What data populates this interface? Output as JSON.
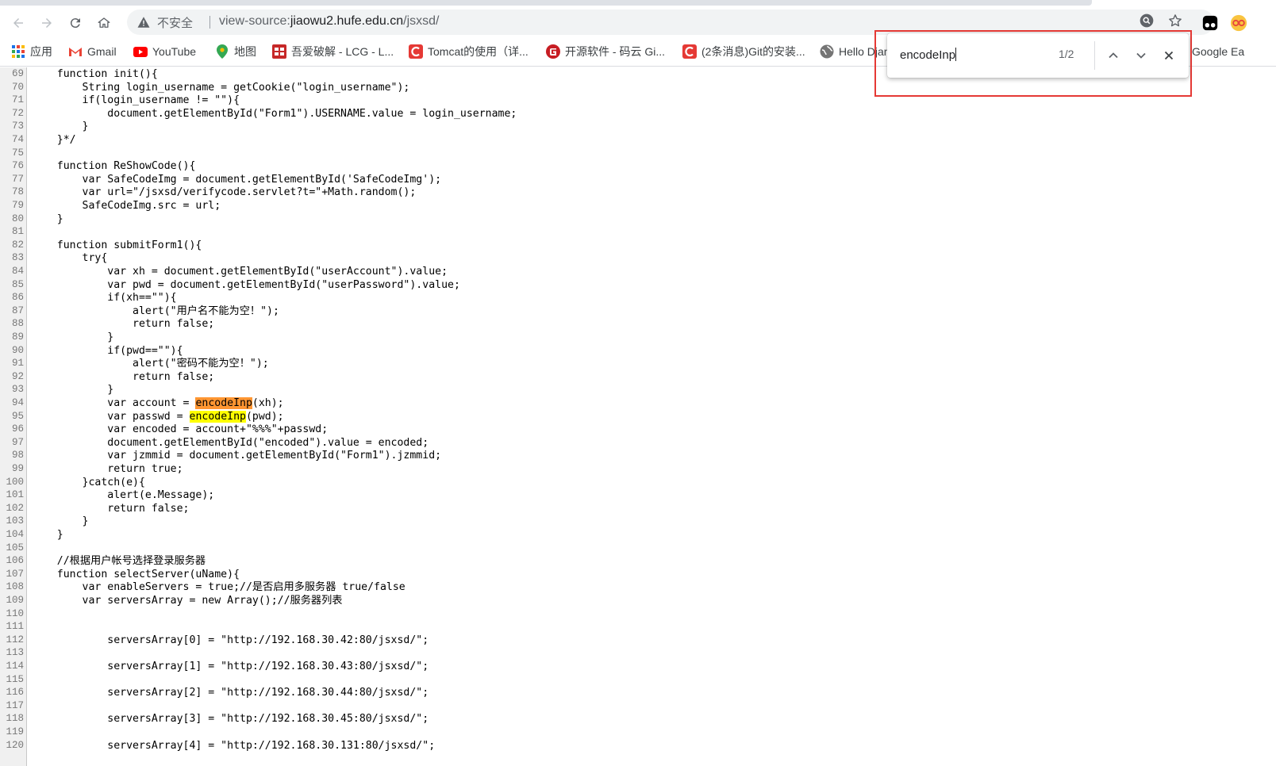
{
  "browser": {
    "insecure_label": "不安全",
    "url_prefix": "view-source:",
    "url_host": "jiaowu2.hufe.edu.cn",
    "url_path": "/jsxsd/"
  },
  "bookmarks": [
    {
      "label": "应用",
      "icon": "apps-grid-icon"
    },
    {
      "label": "Gmail",
      "icon": "gmail-icon"
    },
    {
      "label": "YouTube",
      "icon": "youtube-icon"
    },
    {
      "label": "地图",
      "icon": "maps-pin-icon"
    },
    {
      "label": "吾爱破解 - LCG - L...",
      "icon": "52pojie-icon"
    },
    {
      "label": "Tomcat的使用（详...",
      "icon": "csdn-icon"
    },
    {
      "label": "开源软件 - 码云 Gi...",
      "icon": "gitee-icon"
    },
    {
      "label": "(2条消息)Git的安装...",
      "icon": "csdn-icon"
    },
    {
      "label": "Hello Djan",
      "icon": "globe-icon"
    },
    {
      "label": "Google Ea",
      "icon": "google-earth-icon"
    }
  ],
  "find_bar": {
    "query": "encodeInp",
    "count": "1/2"
  },
  "source": {
    "lines": [
      {
        "n": "69",
        "text": "    function init(){"
      },
      {
        "n": "70",
        "text": "        String login_username = getCookie(\"login_username\");"
      },
      {
        "n": "71",
        "text": "        if(login_username != \"\"){"
      },
      {
        "n": "72",
        "text": "            document.getElementById(\"Form1\").USERNAME.value = login_username;"
      },
      {
        "n": "73",
        "text": "        }"
      },
      {
        "n": "74",
        "text": "    }*/"
      },
      {
        "n": "75",
        "text": ""
      },
      {
        "n": "76",
        "text": "    function ReShowCode(){"
      },
      {
        "n": "77",
        "text": "        var SafeCodeImg = document.getElementById('SafeCodeImg');"
      },
      {
        "n": "78",
        "text": "        var url=\"/jsxsd/verifycode.servlet?t=\"+Math.random();"
      },
      {
        "n": "79",
        "text": "        SafeCodeImg.src = url;"
      },
      {
        "n": "80",
        "text": "    }"
      },
      {
        "n": "81",
        "text": ""
      },
      {
        "n": "82",
        "text": "    function submitForm1(){"
      },
      {
        "n": "83",
        "text": "        try{"
      },
      {
        "n": "84",
        "text": "            var xh = document.getElementById(\"userAccount\").value;"
      },
      {
        "n": "85",
        "text": "            var pwd = document.getElementById(\"userPassword\").value;"
      },
      {
        "n": "86",
        "text": "            if(xh==\"\"){"
      },
      {
        "n": "87",
        "text": "                alert(\"用户名不能为空！\");"
      },
      {
        "n": "88",
        "text": "                return false;"
      },
      {
        "n": "89",
        "text": "            }"
      },
      {
        "n": "90",
        "text": "            if(pwd==\"\"){"
      },
      {
        "n": "91",
        "text": "                alert(\"密码不能为空！\");"
      },
      {
        "n": "92",
        "text": "                return false;"
      },
      {
        "n": "93",
        "text": "            }"
      },
      {
        "n": "94",
        "pre": "            var account = ",
        "match": "encodeInp",
        "post": "(xh);",
        "active": true
      },
      {
        "n": "95",
        "pre": "            var passwd = ",
        "match": "encodeInp",
        "post": "(pwd);",
        "active": false
      },
      {
        "n": "96",
        "text": "            var encoded = account+\"%%%\"+passwd;"
      },
      {
        "n": "97",
        "text": "            document.getElementById(\"encoded\").value = encoded;"
      },
      {
        "n": "98",
        "text": "            var jzmmid = document.getElementById(\"Form1\").jzmmid;"
      },
      {
        "n": "99",
        "text": "            return true;"
      },
      {
        "n": "100",
        "text": "        }catch(e){"
      },
      {
        "n": "101",
        "text": "            alert(e.Message);"
      },
      {
        "n": "102",
        "text": "            return false;"
      },
      {
        "n": "103",
        "text": "        }"
      },
      {
        "n": "104",
        "text": "    }"
      },
      {
        "n": "105",
        "text": ""
      },
      {
        "n": "106",
        "text": "    //根据用户帐号选择登录服务器"
      },
      {
        "n": "107",
        "text": "    function selectServer(uName){"
      },
      {
        "n": "108",
        "text": "        var enableServers = true;//是否启用多服务器 true/false"
      },
      {
        "n": "109",
        "text": "        var serversArray = new Array();//服务器列表"
      },
      {
        "n": "110",
        "text": ""
      },
      {
        "n": "111",
        "text": ""
      },
      {
        "n": "112",
        "text": "            serversArray[0] = \"http://192.168.30.42:80/jsxsd/\";"
      },
      {
        "n": "113",
        "text": ""
      },
      {
        "n": "114",
        "text": "            serversArray[1] = \"http://192.168.30.43:80/jsxsd/\";"
      },
      {
        "n": "115",
        "text": ""
      },
      {
        "n": "116",
        "text": "            serversArray[2] = \"http://192.168.30.44:80/jsxsd/\";"
      },
      {
        "n": "117",
        "text": ""
      },
      {
        "n": "118",
        "text": "            serversArray[3] = \"http://192.168.30.45:80/jsxsd/\";"
      },
      {
        "n": "119",
        "text": ""
      },
      {
        "n": "120",
        "text": "            serversArray[4] = \"http://192.168.30.131:80/jsxsd/\";"
      }
    ]
  },
  "colors": {
    "active_match": "#ff9632",
    "other_match": "#ffff00",
    "annotation_box": "#e53935"
  }
}
